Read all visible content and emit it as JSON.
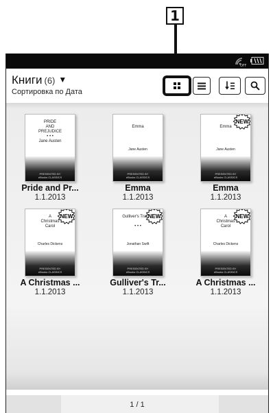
{
  "callout": {
    "label": "1"
  },
  "header": {
    "title": "Книги",
    "count": "(6)",
    "sort_label": "Сортировка по Дата"
  },
  "toolbar": {
    "grid_view_icon": "grid-view-icon",
    "list_view_icon": "list-view-icon",
    "sort_icon": "sort-icon",
    "search_icon": "search-icon"
  },
  "books": [
    {
      "title": "Pride and Pr...",
      "date": "1.1.2013",
      "cover_title": "PRIDE\nAND\nPREJUDICE\n• • •\nJane Austen",
      "cover_author": "",
      "new": false
    },
    {
      "title": "Emma",
      "date": "1.1.2013",
      "cover_title": "\nEmma",
      "cover_author": "Jane Austen",
      "new": false
    },
    {
      "title": "Emma",
      "date": "1.1.2013",
      "cover_title": "\nEmma",
      "cover_author": "Jane Austen",
      "new": true
    },
    {
      "title": "A Christmas ...",
      "date": "1.1.2013",
      "cover_title": "A\nChristmas\nCarol",
      "cover_author": "Charles Dickens",
      "new": true
    },
    {
      "title": "Gulliver's Tr...",
      "date": "1.1.2013",
      "cover_title": "Gulliver's Travels\n\n• • •",
      "cover_author": "Jonathan Swift",
      "new": true
    },
    {
      "title": "A Christmas ...",
      "date": "1.1.2013",
      "cover_title": "A\nChristmas\nCarol",
      "cover_author": "Charles Dickens",
      "new": true
    }
  ],
  "cover_footer_text": "PRESENTED BY\neBooks CLASSICS",
  "new_badge_text": "NEW",
  "pagination": {
    "label": "1 / 1"
  }
}
